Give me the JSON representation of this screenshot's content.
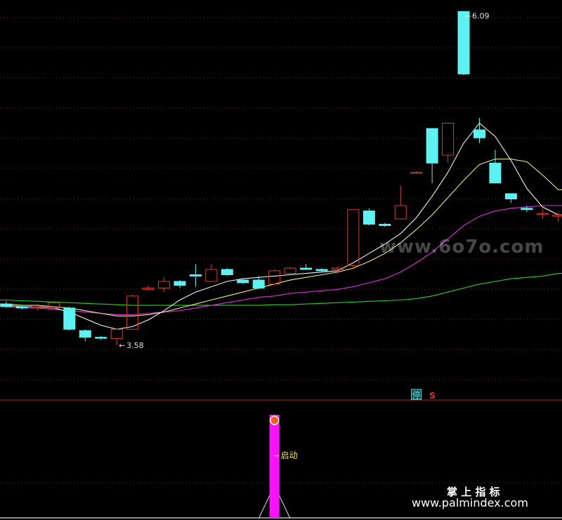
{
  "chart_data": {
    "type": "candlestick",
    "background": "#000000",
    "grid": true,
    "colors": {
      "up": "#d0422e",
      "down": "#5cf2f2",
      "ma_fast": "#f4f4f4",
      "ma_mid": "#eaea80",
      "ma_slow": "#e02ee0",
      "ma_long": "#28d428",
      "grid": "#7a1e1e",
      "signal_bar": "#ff10ff",
      "signal_text": "#ffe040",
      "label": "#e0e0e0"
    },
    "price_range": [
      3.3,
      6.15
    ],
    "candles": [
      {
        "o": 3.89,
        "h": 3.91,
        "l": 3.86,
        "c": 3.87
      },
      {
        "o": 3.87,
        "h": 3.88,
        "l": 3.85,
        "c": 3.86
      },
      {
        "o": 3.87,
        "h": 3.89,
        "l": 3.84,
        "c": 3.87
      },
      {
        "o": 3.86,
        "h": 3.91,
        "l": 3.85,
        "c": 3.9
      },
      {
        "o": 3.86,
        "h": 3.87,
        "l": 3.69,
        "c": 3.7
      },
      {
        "o": 3.69,
        "h": 3.7,
        "l": 3.61,
        "c": 3.64
      },
      {
        "o": 3.64,
        "h": 3.65,
        "l": 3.62,
        "c": 3.635
      },
      {
        "o": 3.63,
        "h": 3.71,
        "l": 3.58,
        "c": 3.7
      },
      {
        "o": 3.7,
        "h": 3.96,
        "l": 3.7,
        "c": 3.95
      },
      {
        "o": 4.0,
        "h": 4.03,
        "l": 3.99,
        "c": 4.01
      },
      {
        "o": 4.01,
        "h": 4.09,
        "l": 3.98,
        "c": 4.06
      },
      {
        "o": 4.06,
        "h": 4.07,
        "l": 4.01,
        "c": 4.03
      },
      {
        "o": 4.11,
        "h": 4.19,
        "l": 4.02,
        "c": 4.1
      },
      {
        "o": 4.06,
        "h": 4.19,
        "l": 4.06,
        "c": 4.15
      },
      {
        "o": 4.15,
        "h": 4.16,
        "l": 4.1,
        "c": 4.11
      },
      {
        "o": 4.07,
        "h": 4.08,
        "l": 4.04,
        "c": 4.05
      },
      {
        "o": 4.07,
        "h": 4.1,
        "l": 4.0,
        "c": 4.01
      },
      {
        "o": 4.04,
        "h": 4.15,
        "l": 4.03,
        "c": 4.14
      },
      {
        "o": 4.12,
        "h": 4.17,
        "l": 4.11,
        "c": 4.16
      },
      {
        "o": 4.16,
        "h": 4.19,
        "l": 4.15,
        "c": 4.15
      },
      {
        "o": 4.15,
        "h": 4.16,
        "l": 4.13,
        "c": 4.14
      },
      {
        "o": 4.15,
        "h": 4.17,
        "l": 4.12,
        "c": 4.16
      },
      {
        "o": 4.18,
        "h": 4.6,
        "l": 4.15,
        "c": 4.6
      },
      {
        "o": 4.59,
        "h": 4.61,
        "l": 4.48,
        "c": 4.49
      },
      {
        "o": 4.49,
        "h": 4.5,
        "l": 4.47,
        "c": 4.48
      },
      {
        "o": 4.53,
        "h": 4.78,
        "l": 4.53,
        "c": 4.63
      },
      {
        "o": 4.88,
        "h": 4.89,
        "l": 4.87,
        "c": 4.88
      },
      {
        "o": 5.21,
        "h": 5.21,
        "l": 4.8,
        "c": 4.95
      },
      {
        "o": 5.01,
        "h": 5.25,
        "l": 4.95,
        "c": 5.25
      },
      {
        "o": 6.09,
        "h": 6.09,
        "l": 5.61,
        "c": 5.62
      },
      {
        "o": 5.2,
        "h": 5.29,
        "l": 5.1,
        "c": 5.14
      },
      {
        "o": 4.95,
        "h": 5.05,
        "l": 4.8,
        "c": 4.8
      },
      {
        "o": 4.72,
        "h": 4.72,
        "l": 4.65,
        "c": 4.68
      },
      {
        "o": 4.61,
        "h": 4.63,
        "l": 4.58,
        "c": 4.6
      },
      {
        "o": 4.57,
        "h": 4.61,
        "l": 4.53,
        "c": 4.57
      },
      {
        "o": 4.55,
        "h": 4.58,
        "l": 4.51,
        "c": 4.56
      }
    ],
    "ma_fast": [
      3.88,
      3.87,
      3.87,
      3.86,
      3.83,
      3.78,
      3.73,
      3.7,
      3.72,
      3.77,
      3.84,
      3.92,
      3.98,
      4.02,
      4.06,
      4.08,
      4.09,
      4.1,
      4.11,
      4.12,
      4.13,
      4.14,
      4.2,
      4.27,
      4.34,
      4.42,
      4.54,
      4.7,
      4.88,
      5.1,
      5.25,
      5.15,
      4.97,
      4.76,
      4.62,
      4.56
    ],
    "ma_mid": [
      3.89,
      3.88,
      3.88,
      3.87,
      3.86,
      3.84,
      3.82,
      3.8,
      3.8,
      3.81,
      3.83,
      3.86,
      3.89,
      3.92,
      3.95,
      3.98,
      4.01,
      4.04,
      4.07,
      4.09,
      4.11,
      4.13,
      4.16,
      4.21,
      4.27,
      4.35,
      4.45,
      4.56,
      4.69,
      4.82,
      4.94,
      4.98,
      4.98,
      4.96,
      4.86,
      4.75
    ],
    "ma_slow": [
      3.87,
      3.86,
      3.86,
      3.85,
      3.84,
      3.83,
      3.82,
      3.81,
      3.81,
      3.82,
      3.83,
      3.84,
      3.86,
      3.88,
      3.9,
      3.92,
      3.94,
      3.95,
      3.97,
      3.98,
      3.99,
      4.0,
      4.02,
      4.05,
      4.08,
      4.13,
      4.2,
      4.28,
      4.38,
      4.48,
      4.55,
      4.59,
      4.61,
      4.62,
      4.63,
      4.63
    ],
    "ma_long": [
      3.92,
      3.915,
      3.91,
      3.905,
      3.9,
      3.895,
      3.89,
      3.885,
      3.88,
      3.88,
      3.88,
      3.88,
      3.88,
      3.88,
      3.88,
      3.88,
      3.88,
      3.885,
      3.885,
      3.89,
      3.895,
      3.9,
      3.905,
      3.91,
      3.915,
      3.92,
      3.93,
      3.95,
      3.98,
      4.01,
      4.04,
      4.06,
      4.08,
      4.09,
      4.1,
      4.12
    ],
    "annotations": {
      "high_label": "6.09",
      "low_label": "3.58",
      "high_index": 29,
      "low_index": 7
    },
    "markers": {
      "stop_label": "停",
      "s_label": "S",
      "stop_index": 26,
      "s_index": 27
    },
    "indicator": {
      "signal_label": "启动",
      "signal_index": 17,
      "signal_value": 1.0
    }
  },
  "watermarks": {
    "top": "www.6o7o.com",
    "bottom_cn": "掌 上 指 标",
    "bottom_url": "www.palmindex.com"
  }
}
